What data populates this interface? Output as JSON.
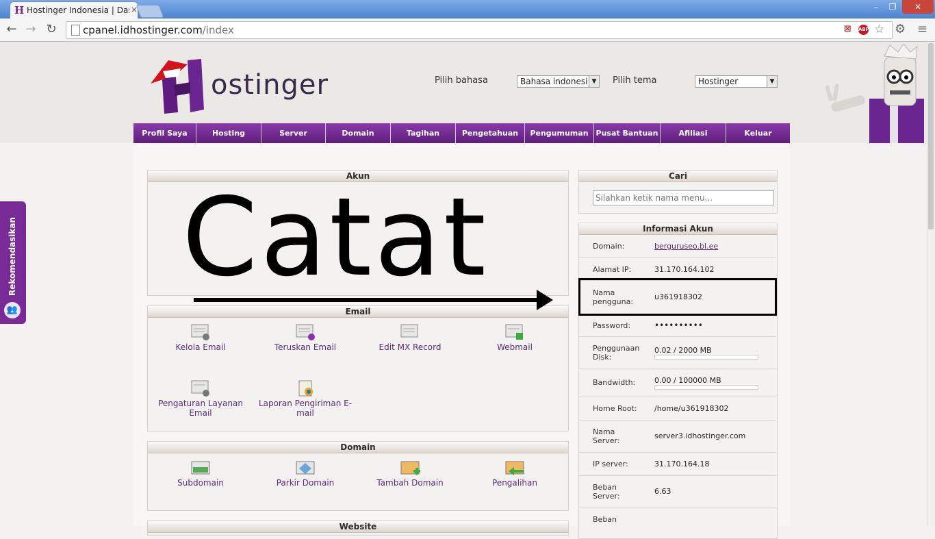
{
  "browser": {
    "tab_title": "Hostinger Indonesia | Dasl",
    "tab_close": "×",
    "url_host": "cpanel.idhostinger.com",
    "url_path": "/index",
    "window_min": "–",
    "window_max": "❐",
    "window_close": "✕"
  },
  "header": {
    "logo_text": "ostinger",
    "lang_label": "Pilih bahasa",
    "lang_value": "Bahasa indonesi",
    "theme_label": "Pilih tema",
    "theme_value": "Hostinger"
  },
  "nav": [
    "Profil Saya",
    "Hosting",
    "Server",
    "Domain",
    "Tagihan",
    "Pengetahuan",
    "Pengumuman",
    "Pusat Bantuan",
    "Afiliasi",
    "Keluar"
  ],
  "akun": {
    "title": "Akun",
    "annotation": "Catat"
  },
  "email": {
    "title": "Email",
    "tiles": [
      "Kelola Email",
      "Teruskan Email",
      "Edit MX Record",
      "Webmail",
      "Pengaturan Layanan Email",
      "Laporan Pengiriman E-mail"
    ]
  },
  "domain": {
    "title": "Domain",
    "tiles": [
      "Subdomain",
      "Parkir Domain",
      "Tambah Domain",
      "Pengalihan"
    ]
  },
  "website": {
    "title": "Website"
  },
  "search": {
    "title": "Cari",
    "placeholder": "Silahkan ketik nama menu..."
  },
  "info": {
    "title": "Informasi Akun",
    "rows": [
      {
        "key": "Domain:",
        "value": "berguruseo.bl.ee"
      },
      {
        "key": "Alamat IP:",
        "value": "31.170.164.102"
      },
      {
        "key": "Nama pengguna:",
        "value": "u361918302"
      },
      {
        "key": "Password:",
        "value": "••••••••••"
      },
      {
        "key": "Penggunaan Disk:",
        "value": "0.02 / 2000 MB",
        "progress": 0.0
      },
      {
        "key": "Bandwidth:",
        "value": "0.00 / 100000 MB",
        "progress": 0.0
      },
      {
        "key": "Home Root:",
        "value": "/home/u361918302"
      },
      {
        "key": "Nama Server:",
        "value": "server3.idhostinger.com"
      },
      {
        "key": "IP server:",
        "value": "31.170.164.18"
      },
      {
        "key": "Beban Server:",
        "value": "6.63"
      },
      {
        "key": "Beban",
        "value": ""
      }
    ]
  },
  "side_tab": {
    "label": "Rekomendasikan"
  },
  "colors": {
    "brand": "#6b2590",
    "nav_bg": "#7a2e9c",
    "highlight": "#000000"
  }
}
